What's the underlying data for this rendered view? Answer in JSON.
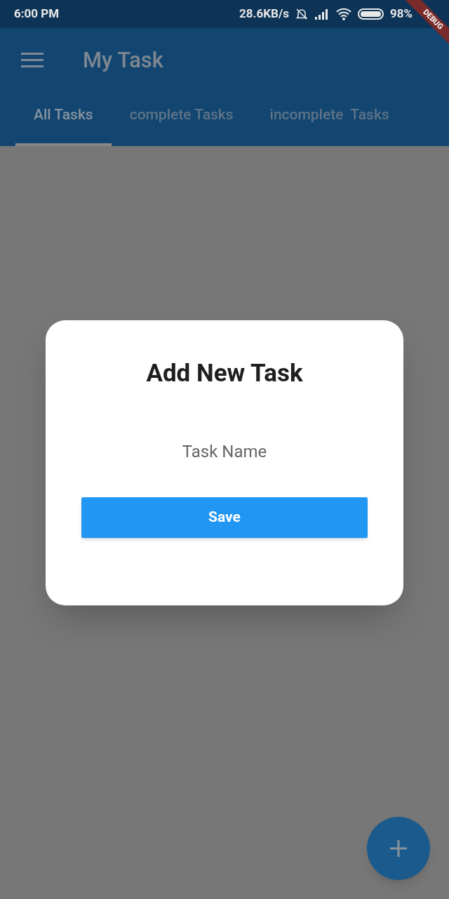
{
  "status_bar": {
    "time": "6:00 PM",
    "speed": "28.6KB/s",
    "battery": "98%"
  },
  "debug_banner": "DEBUG",
  "app_bar": {
    "title": "My Task"
  },
  "tabs": [
    {
      "label": "All Tasks",
      "selected": true
    },
    {
      "label": "complete Tasks",
      "selected": false
    },
    {
      "label": "incomplete  Tasks",
      "selected": false
    }
  ],
  "dialog": {
    "title": "Add New Task",
    "field": {
      "placeholder": "Task Name"
    },
    "button": "Save"
  }
}
